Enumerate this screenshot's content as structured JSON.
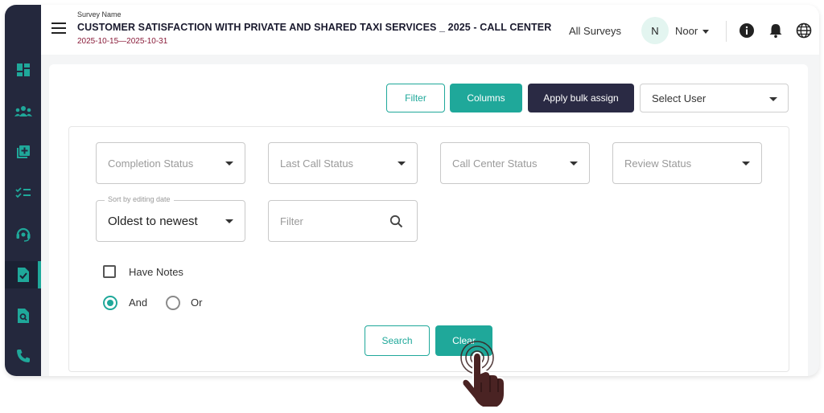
{
  "header": {
    "survey_label": "Survey Name",
    "survey_title": "CUSTOMER SATISFACTION WITH PRIVATE AND SHARED TAXI SERVICES _ 2025 - CALL CENTER",
    "survey_dates": "2025-10-15—2025-10-31",
    "all_surveys": "All Surveys",
    "avatar_initial": "N",
    "user_name": "Noor",
    "icons": [
      "menu-icon",
      "info-icon",
      "bell-icon",
      "globe-icon"
    ]
  },
  "sidebar": {
    "items": [
      {
        "icon": "dashboard-icon",
        "active": false
      },
      {
        "icon": "users-icon",
        "active": false
      },
      {
        "icon": "add-survey-icon",
        "active": false
      },
      {
        "icon": "checklist-icon",
        "active": false
      },
      {
        "icon": "support-agent-icon",
        "active": false
      },
      {
        "icon": "document-check-icon",
        "active": true
      },
      {
        "icon": "document-search-icon",
        "active": false
      },
      {
        "icon": "phone-icon",
        "active": false
      }
    ]
  },
  "toolbar": {
    "filter_label": "Filter",
    "columns_label": "Columns",
    "bulk_assign_label": "Apply bulk assign",
    "select_user_value": "Select User"
  },
  "filters": {
    "completion_status": "Completion Status",
    "last_call_status": "Last Call Status",
    "call_center_status": "Call Center Status",
    "review_status": "Review Status",
    "sort_legend": "Sort by editing date",
    "sort_value": "Oldest to newest",
    "filter_placeholder": "Filter",
    "have_notes_label": "Have Notes",
    "have_notes_checked": false,
    "and_label": "And",
    "or_label": "Or",
    "logic_selected": "And",
    "search_label": "Search",
    "clear_label": "Clear"
  },
  "colors": {
    "accent": "#1fa89a",
    "sidebar": "#24283d",
    "dark_button": "#2a2a44",
    "date_text": "#8a1c3a"
  }
}
